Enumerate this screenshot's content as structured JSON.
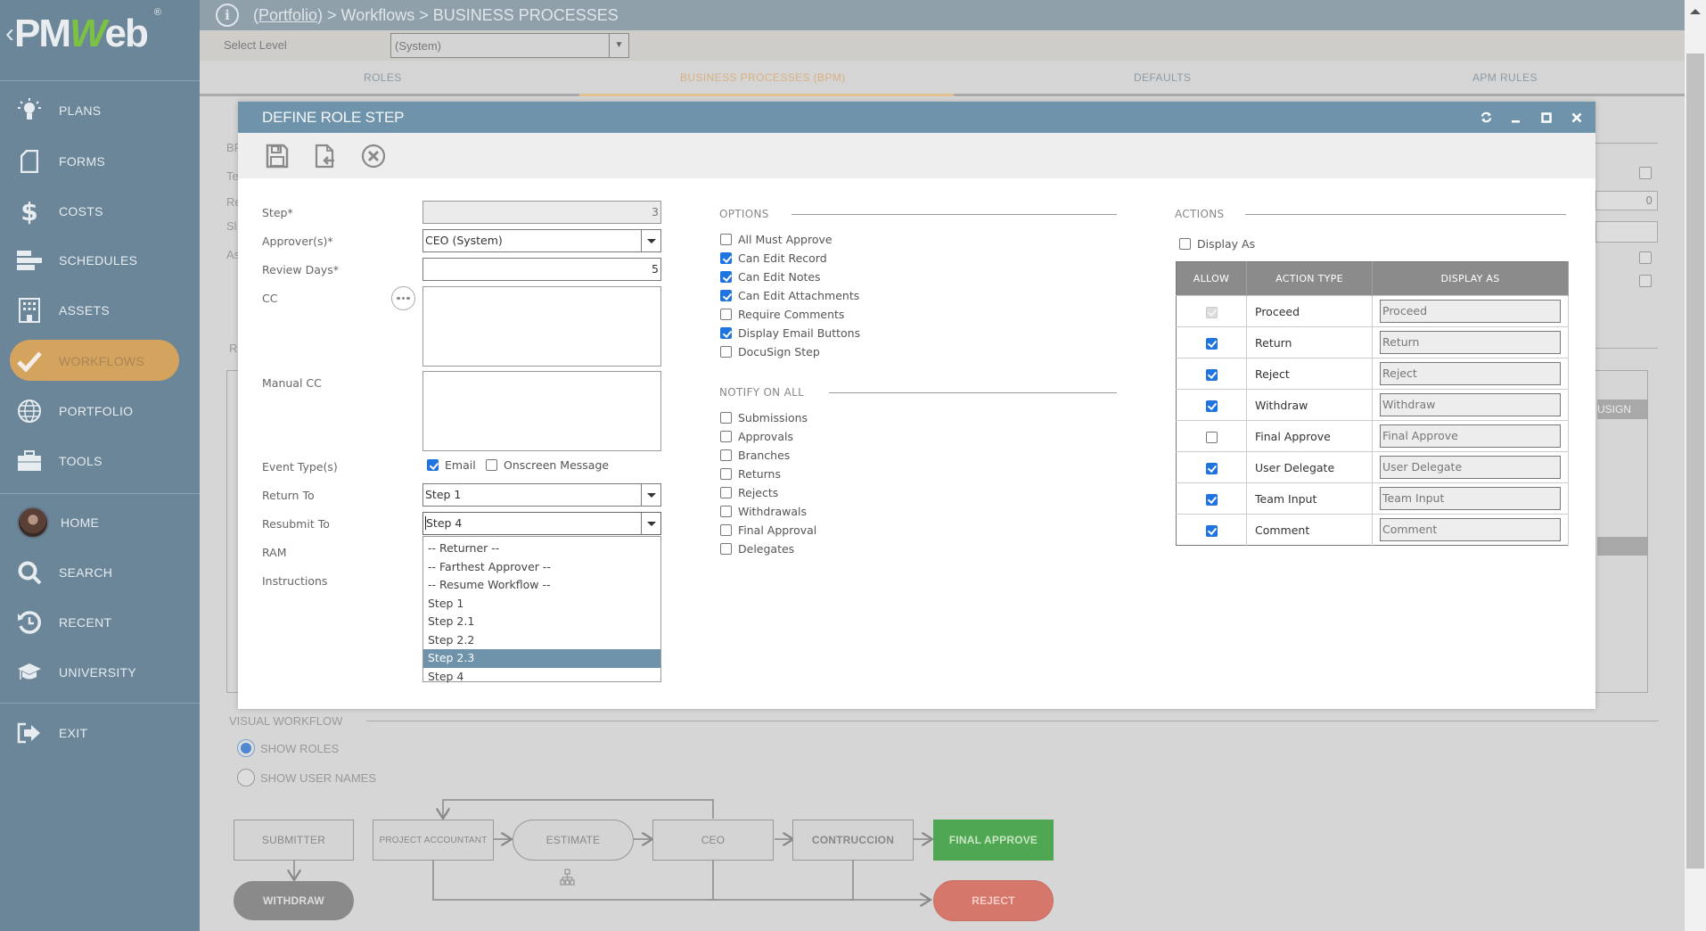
{
  "app": {
    "logo_text": "PMWeb",
    "brand_color": "#6a8698",
    "accent_color": "#d4a35e"
  },
  "sidebar": {
    "items": [
      {
        "label": "PLANS",
        "icon": "lightbulb-icon"
      },
      {
        "label": "FORMS",
        "icon": "document-icon"
      },
      {
        "label": "COSTS",
        "icon": "dollar-icon"
      },
      {
        "label": "SCHEDULES",
        "icon": "gantt-icon"
      },
      {
        "label": "ASSETS",
        "icon": "building-icon"
      },
      {
        "label": "WORKFLOWS",
        "icon": "checkmark-icon",
        "active": true
      },
      {
        "label": "PORTFOLIO",
        "icon": "globe-icon"
      },
      {
        "label": "TOOLS",
        "icon": "toolbox-icon"
      }
    ],
    "bottom_items": [
      {
        "label": "HOME",
        "icon": "avatar"
      },
      {
        "label": "SEARCH",
        "icon": "search-icon"
      },
      {
        "label": "RECENT",
        "icon": "history-icon"
      },
      {
        "label": "UNIVERSITY",
        "icon": "graduation-cap-icon"
      }
    ],
    "exit": {
      "label": "EXIT",
      "icon": "exit-icon"
    }
  },
  "header": {
    "breadcrumb": {
      "link": "(Portfolio)",
      "sep1": " > ",
      "part2": "Workflows",
      "sep2": " > ",
      "part3": "BUSINESS PROCESSES"
    }
  },
  "select_level": {
    "label": "Select Level",
    "value": "(System)"
  },
  "tabs": [
    {
      "label": "ROLES"
    },
    {
      "label": "BUSINESS PROCESSES (BPM)",
      "active": true
    },
    {
      "label": "DEFAULTS"
    },
    {
      "label": "APM RULES"
    }
  ],
  "background": {
    "left_fragments": [
      "BP",
      "Te",
      "Re",
      "Sl",
      "As",
      "R"
    ],
    "right_values": {
      "number_field": "0"
    },
    "table_header_fragment": "USIGN"
  },
  "modal": {
    "title": "DEFINE ROLE STEP",
    "toolbar": {
      "save": "save-icon",
      "import": "import-icon",
      "cancel": "cancel-icon"
    },
    "form": {
      "step": {
        "label": "Step*",
        "value": "3"
      },
      "approvers": {
        "label": "Approver(s)*",
        "value": "CEO (System)"
      },
      "review_days": {
        "label": "Review Days*",
        "value": "5"
      },
      "cc": {
        "label": "CC",
        "value": ""
      },
      "manual_cc": {
        "label": "Manual CC",
        "value": ""
      },
      "event_types": {
        "label": "Event Type(s)",
        "email": {
          "label": "Email",
          "checked": true
        },
        "onscreen": {
          "label": "Onscreen Message",
          "checked": false
        }
      },
      "return_to": {
        "label": "Return To",
        "value": "Step 1"
      },
      "resubmit_to": {
        "label": "Resubmit To",
        "value": "Step 4"
      },
      "ram": {
        "label": "RAM"
      },
      "instructions": {
        "label": "Instructions"
      }
    },
    "resubmit_dropdown": {
      "options": [
        "-- Returner --",
        "-- Farthest Approver --",
        "-- Resume Workflow --",
        "Step 1",
        "Step 2.1",
        "Step 2.2",
        "Step 2.3",
        "Step 4"
      ],
      "highlighted": "Step 2.3"
    },
    "options": {
      "title": "OPTIONS",
      "items": [
        {
          "label": "All Must Approve",
          "checked": false
        },
        {
          "label": "Can Edit Record",
          "checked": true
        },
        {
          "label": "Can Edit Notes",
          "checked": true
        },
        {
          "label": "Can Edit Attachments",
          "checked": true
        },
        {
          "label": "Require Comments",
          "checked": false
        },
        {
          "label": "Display Email Buttons",
          "checked": true
        },
        {
          "label": "DocuSign Step",
          "checked": false
        }
      ]
    },
    "notify": {
      "title": "NOTIFY ON ALL",
      "items": [
        {
          "label": "Submissions",
          "checked": false
        },
        {
          "label": "Approvals",
          "checked": false
        },
        {
          "label": "Branches",
          "checked": false
        },
        {
          "label": "Returns",
          "checked": false
        },
        {
          "label": "Rejects",
          "checked": false
        },
        {
          "label": "Withdrawals",
          "checked": false
        },
        {
          "label": "Final Approval",
          "checked": false
        },
        {
          "label": "Delegates",
          "checked": false
        }
      ]
    },
    "actions": {
      "title": "ACTIONS",
      "display_as": {
        "label": "Display As",
        "checked": false
      },
      "columns": [
        "ALLOW",
        "ACTION TYPE",
        "DISPLAY AS"
      ],
      "rows": [
        {
          "allow": "disabled",
          "type": "Proceed",
          "display": "Proceed"
        },
        {
          "allow": true,
          "type": "Return",
          "display": "Return"
        },
        {
          "allow": true,
          "type": "Reject",
          "display": "Reject"
        },
        {
          "allow": true,
          "type": "Withdraw",
          "display": "Withdraw"
        },
        {
          "allow": false,
          "type": "Final Approve",
          "display": "Final Approve"
        },
        {
          "allow": true,
          "type": "User Delegate",
          "display": "User Delegate"
        },
        {
          "allow": true,
          "type": "Team Input",
          "display": "Team Input"
        },
        {
          "allow": true,
          "type": "Comment",
          "display": "Comment"
        }
      ]
    }
  },
  "visual_workflow": {
    "title": "VISUAL WORKFLOW",
    "radios": [
      {
        "label": "SHOW ROLES",
        "selected": true
      },
      {
        "label": "SHOW USER NAMES",
        "selected": false
      }
    ],
    "nodes": {
      "submitter": "SUBMITTER",
      "withdraw": "WITHDRAW",
      "project_accountant": "PROJECT ACCOUNTANT",
      "estimate": "ESTIMATE",
      "ceo": "CEO",
      "contruccion": "CONTRUCCION",
      "final_approve": "FINAL APPROVE",
      "reject": "REJECT"
    },
    "colors": {
      "final_approve": "#4fa653",
      "reject": "#d6776c",
      "withdraw": "#8a8a8a"
    }
  }
}
